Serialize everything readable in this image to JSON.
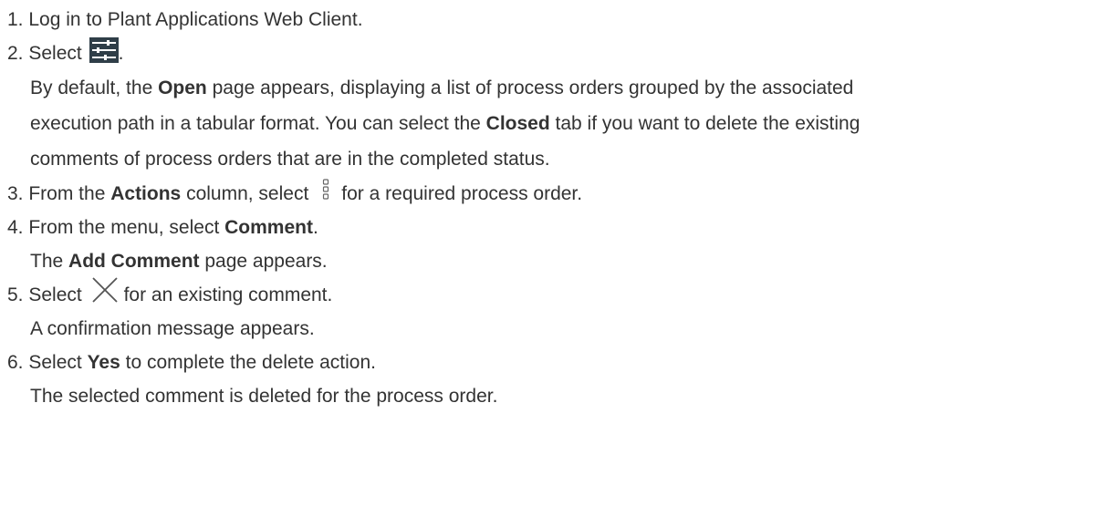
{
  "steps": [
    {
      "num": "1.",
      "text": "Log in to Plant Applications Web Client."
    },
    {
      "num": "2.",
      "pre": "Select",
      "post": ".",
      "icon": "filter-sliders-icon",
      "desc_line1_pre": "By default, the ",
      "desc_line1_bold": "Open",
      "desc_line1_post": " page appears, displaying a list of process orders grouped by the associated",
      "desc_line2_pre": "execution path in a tabular format. You can select the ",
      "desc_line2_bold": "Closed",
      "desc_line2_post": " tab if you want to delete the existing",
      "desc_line3": "comments of process orders that are in the completed status."
    },
    {
      "num": "3.",
      "pre": "From the ",
      "bold": "Actions",
      "mid": " column, select",
      "post": "for a required process order.",
      "icon": "kebab-menu-icon"
    },
    {
      "num": "4.",
      "pre": "From the menu, select ",
      "bold": "Comment",
      "post": ".",
      "desc_pre": "The ",
      "desc_bold": "Add Comment",
      "desc_post": " page appears."
    },
    {
      "num": "5.",
      "pre": "Select",
      "post": "for an existing comment.",
      "icon": "close-icon",
      "desc": "A confirmation message appears."
    },
    {
      "num": "6.",
      "pre": "Select ",
      "bold": "Yes",
      "post": " to complete the delete action.",
      "desc": "The selected comment is deleted for the process order."
    }
  ]
}
